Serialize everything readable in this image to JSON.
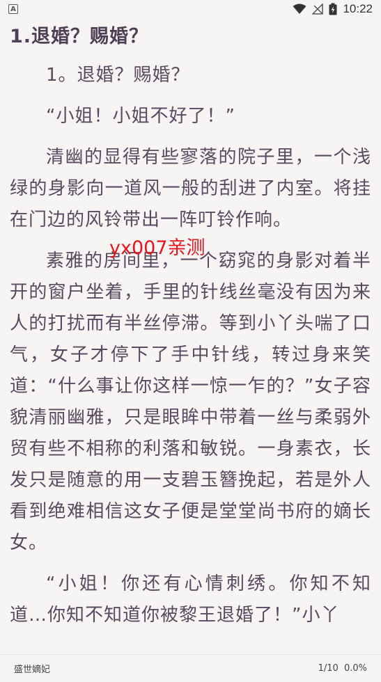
{
  "status_bar": {
    "left_icon": "A",
    "time": "10:22"
  },
  "chapter": {
    "title": "1.退婚？赐婚？",
    "paragraphs": [
      "1。退婚？赐婚？",
      "“小姐！小姐不好了！”",
      "清幽的显得有些寥落的院子里，一个浅绿的身影向一道风一般的刮进了内室。将挂在门边的风铃带出一阵叮铃作响。",
      "素雅的房间里，一个窈窕的身影对着半开的窗户坐着，手里的针线丝毫没有因为来人的打扰而有半丝停滞。等到小丫头喘了口气，女子才停下了手中针线，转过身来笑道：“什么事让你这样一惊一乍的？”女子容貌清丽幽雅，只是眼眸中带着一丝与柔弱外贸有些不相称的利落和敏锐。一身素衣，长发只是随意的用一支碧玉簪挽起，若是外人看到绝难相信这女子便是堂堂尚书府的嫡长女。",
      "“小姐！你还有心情刺绣。你知不知道…你知不知道你被黎王退婚了！”小丫"
    ]
  },
  "watermark": "yx007亲测",
  "footer": {
    "book_title": "盛世嫡妃",
    "page": "1/10",
    "progress": "0.0%"
  }
}
